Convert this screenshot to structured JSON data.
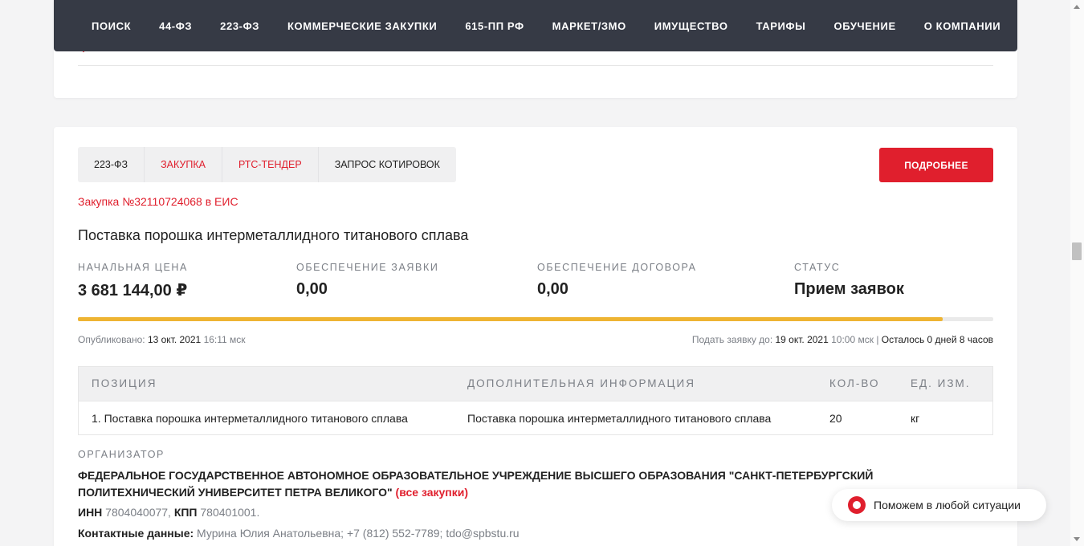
{
  "nav": {
    "items": [
      "ПОИСК",
      "44-ФЗ",
      "223-ФЗ",
      "КОММЕРЧЕСКИЕ ЗАКУПКИ",
      "615-ПП РФ",
      "МАРКЕТ/ЗМО",
      "ИМУЩЕСТВО",
      "ТАРИФЫ",
      "ОБУЧЕНИЕ",
      "О КОМПАНИИ"
    ]
  },
  "tender": {
    "tags": [
      "223-ФЗ",
      "ЗАКУПКА",
      "РТС-ТЕНДЕР",
      "ЗАПРОС КОТИРОВОК"
    ],
    "more_button": "ПОДРОБНЕЕ",
    "eis_link": "Закупка №32110724068 в ЕИС",
    "title": "Поставка порошка интерметаллидного титанового сплава",
    "metrics": [
      {
        "label": "НАЧАЛЬНАЯ ЦЕНА",
        "value": "3 681 144,00 ₽"
      },
      {
        "label": "ОБЕСПЕЧЕНИЕ ЗАЯВКИ",
        "value": "0,00"
      },
      {
        "label": "ОБЕСПЕЧЕНИЕ ДОГОВОРА",
        "value": "0,00"
      },
      {
        "label": "СТАТУС",
        "value": "Прием заявок"
      }
    ],
    "progress_fraction": 0.945,
    "published": {
      "label": "Опубликовано: ",
      "date": "13 окт. 2021",
      "time": " 16:11 мск"
    },
    "deadline": {
      "label": "Подать заявку до: ",
      "date": "19 окт. 2021",
      "time": " 10:00 мск | ",
      "remaining": "Осталось 0 дней 8 часов"
    },
    "table": {
      "headers": [
        "ПОЗИЦИЯ",
        "ДОПОЛНИТЕЛЬНАЯ ИНФОРМАЦИЯ",
        "КОЛ-ВО",
        "ЕД. ИЗМ."
      ],
      "rows": [
        [
          "1. Поставка порошка интерметаллидного титанового сплава",
          "Поставка порошка интерметаллидного титанового сплава",
          "20",
          "кг"
        ]
      ]
    },
    "organizer": {
      "label": "ОРГАНИЗАТОР",
      "name": "ФЕДЕРАЛЬНОЕ ГОСУДАРСТВЕННОЕ АВТОНОМНОЕ ОБРАЗОВАТЕЛЬНОЕ УЧРЕЖДЕНИЕ ВЫСШЕГО ОБРАЗОВАНИЯ \"САНКТ-ПЕТЕРБУРГСКИЙ ПОЛИТЕХНИЧЕСКИЙ УНИВЕРСИТЕТ ПЕТРА ВЕЛИКОГО\"",
      "all_link": " (все закупки)",
      "inn_label": "ИНН",
      "inn": " 7804040077, ",
      "kpp_label": "КПП",
      "kpp": " 780401001.",
      "contacts_label": "Контактные данные:",
      "contacts": " Мурина Юлия Анатольевна; +7 (812) 552-7789; tdo@spbstu.ru"
    }
  },
  "help_widget": {
    "text": "Поможем в любой ситуации"
  },
  "colors": {
    "accent": "#e01f2d",
    "nav_bg": "#363a45",
    "progress": "#eeb433"
  }
}
